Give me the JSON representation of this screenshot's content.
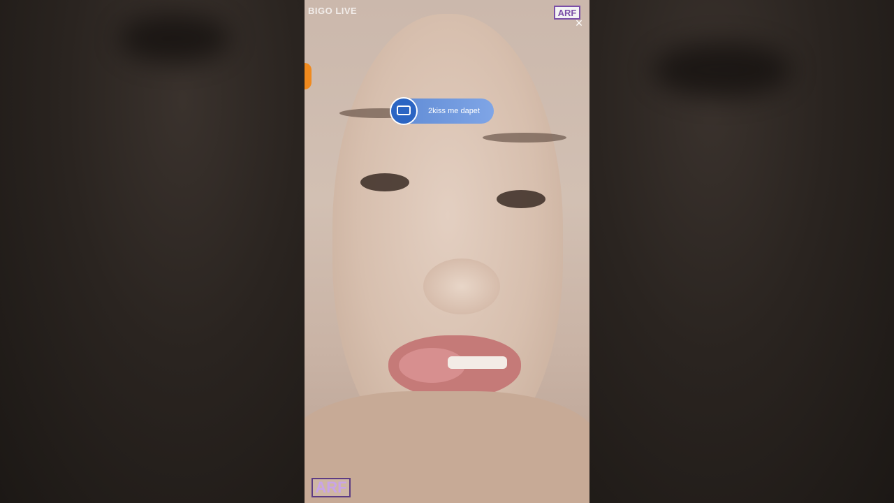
{
  "watermark": {
    "brand": "BIGO LIVE"
  },
  "logo": {
    "text": "ARF"
  },
  "close": {
    "glyph": "×"
  },
  "notification": {
    "message": "2kiss me dapet"
  },
  "colors": {
    "pill": "#6f98dd",
    "avatar": "#2b65c3",
    "accent": "#f08a1e"
  }
}
